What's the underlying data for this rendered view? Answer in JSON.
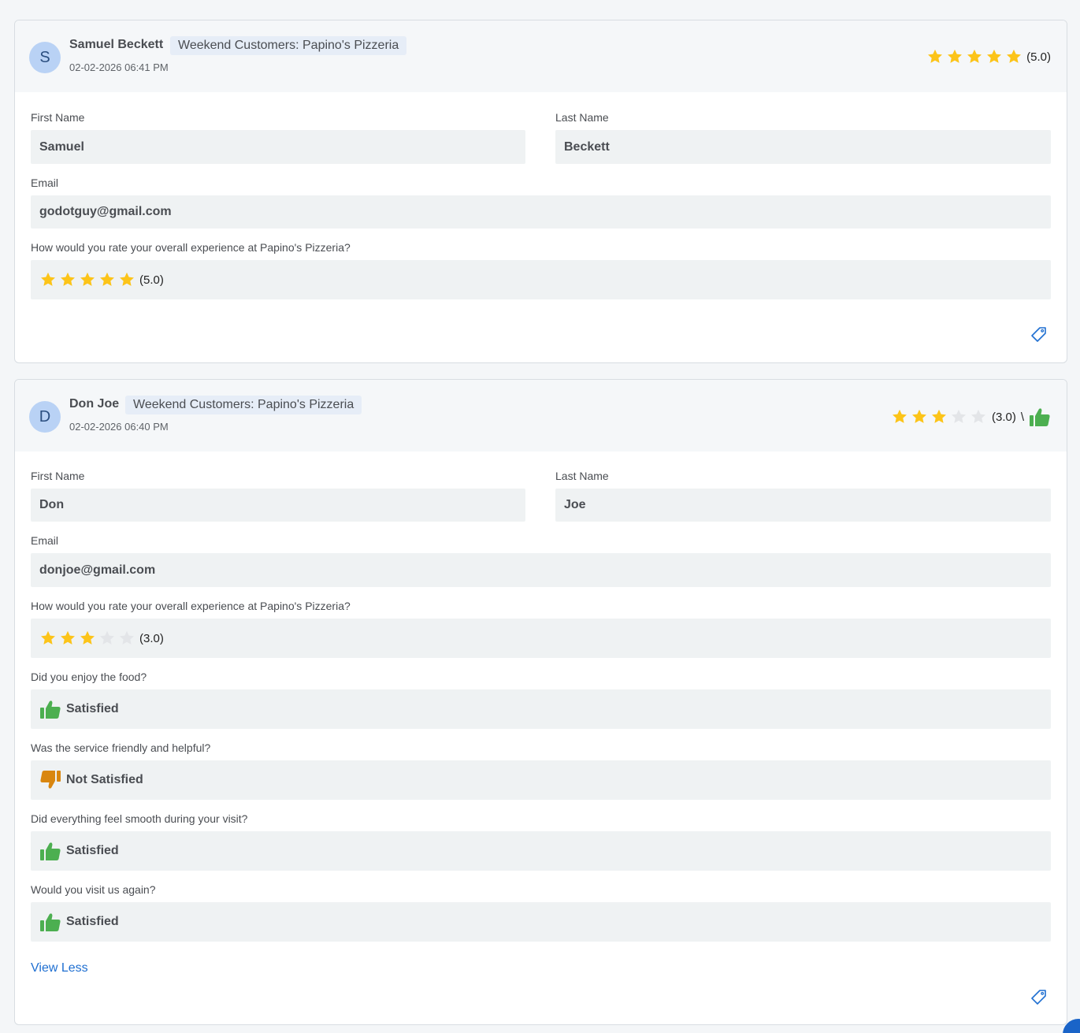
{
  "responses": [
    {
      "avatar_letter": "S",
      "name": "Samuel Beckett",
      "group": "Weekend Customers: Papino's Pizzeria",
      "date": "02-02-2026 06:41 PM",
      "header_rating": "(5.0)",
      "header_stars": 5,
      "fields": {
        "first_name_label": "First Name",
        "first_name": "Samuel",
        "last_name_label": "Last Name",
        "last_name": "Beckett",
        "email_label": "Email",
        "email": "godotguy@gmail.com",
        "q_rating_label": "How would you rate your overall experience at Papino's Pizzeria?",
        "q_rating_value": "(5.0)",
        "q_rating_stars": 5
      }
    },
    {
      "avatar_letter": "D",
      "name": "Don Joe",
      "group": "Weekend Customers: Papino's Pizzeria",
      "date": "02-02-2026 06:40 PM",
      "header_rating": "(3.0)",
      "header_separator": "\\",
      "header_stars": 3,
      "fields": {
        "first_name_label": "First Name",
        "first_name": "Don",
        "last_name_label": "Last Name",
        "last_name": "Joe",
        "email_label": "Email",
        "email": "donjoe@gmail.com",
        "q_rating_label": "How would you rate your overall experience at Papino's Pizzeria?",
        "q_rating_value": "(3.0)",
        "q_rating_stars": 3,
        "q_food_label": "Did you enjoy the food?",
        "q_food_value": "Satisfied",
        "q_service_label": "Was the service friendly and helpful?",
        "q_service_value": "Not Satisfied",
        "q_smooth_label": "Did everything feel smooth during your visit?",
        "q_smooth_value": "Satisfied",
        "q_visit_label": "Would you visit us again?",
        "q_visit_value": "Satisfied"
      },
      "view_less": "View Less"
    }
  ],
  "colors": {
    "star_filled": "#fcc419",
    "star_empty": "#e3e5e8",
    "thumb_up": "#4caf50",
    "thumb_down": "#d9860f",
    "link": "#1f6fd1"
  },
  "icons": {
    "star": "star-icon",
    "thumbs_up": "thumbs-up-icon",
    "thumbs_down": "thumbs-down-icon",
    "tag": "tag-icon"
  }
}
